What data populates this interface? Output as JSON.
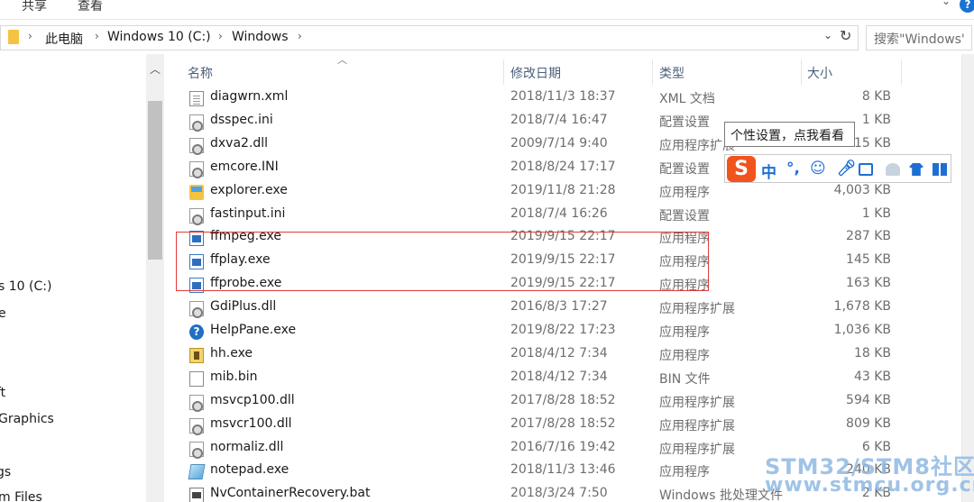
{
  "ribbon": {
    "tabs": [
      "共享",
      "查看"
    ],
    "help_label": "?"
  },
  "address": {
    "crumbs": [
      "此电脑",
      "Windows 10 (C:)",
      "Windows"
    ],
    "dropdown_glyph": "⌄",
    "refresh_glyph": "↻"
  },
  "search": {
    "placeholder": "搜索\"Windows\""
  },
  "nav": {
    "items": [
      "s 10 (C:)",
      "e",
      "ft",
      "Graphics",
      "",
      "gs",
      "m Files"
    ]
  },
  "columns": {
    "name": "名称",
    "date": "修改日期",
    "type": "类型",
    "size": "大小"
  },
  "files": [
    {
      "name": "diagwrn.xml",
      "date": "2018/11/3 18:37",
      "type": "XML 文档",
      "size": "8 KB",
      "icon": "xml-doc-icon"
    },
    {
      "name": "dsspec.ini",
      "date": "2018/7/4 16:47",
      "type": "配置设置",
      "size": "1 KB",
      "icon": "config-file-icon"
    },
    {
      "name": "dxva2.dll",
      "date": "2009/7/14 9:40",
      "type": "应用程序扩展",
      "size": "15 KB",
      "icon": "dll-file-icon"
    },
    {
      "name": "emcore.INI",
      "date": "2018/8/24 17:17",
      "type": "配置设置",
      "size": "",
      "icon": "config-file-icon"
    },
    {
      "name": "explorer.exe",
      "date": "2019/11/8 21:28",
      "type": "应用程序",
      "size": "4,003 KB",
      "icon": "explorer-icon"
    },
    {
      "name": "fastinput.ini",
      "date": "2018/7/4 16:26",
      "type": "配置设置",
      "size": "1 KB",
      "icon": "config-file-icon"
    },
    {
      "name": "ffmpeg.exe",
      "date": "2019/9/15 22:17",
      "type": "应用程序",
      "size": "287 KB",
      "icon": "app-window-icon"
    },
    {
      "name": "ffplay.exe",
      "date": "2019/9/15 22:17",
      "type": "应用程序",
      "size": "145 KB",
      "icon": "app-window-icon"
    },
    {
      "name": "ffprobe.exe",
      "date": "2019/9/15 22:17",
      "type": "应用程序",
      "size": "163 KB",
      "icon": "app-window-icon"
    },
    {
      "name": "GdiPlus.dll",
      "date": "2016/8/3 17:27",
      "type": "应用程序扩展",
      "size": "1,678 KB",
      "icon": "dll-file-icon"
    },
    {
      "name": "HelpPane.exe",
      "date": "2019/8/22 17:23",
      "type": "应用程序",
      "size": "1,036 KB",
      "icon": "help-icon"
    },
    {
      "name": "hh.exe",
      "date": "2018/4/12 7:34",
      "type": "应用程序",
      "size": "18 KB",
      "icon": "help-book-icon"
    },
    {
      "name": "mib.bin",
      "date": "2018/4/12 7:34",
      "type": "BIN 文件",
      "size": "43 KB",
      "icon": "blank-file-icon"
    },
    {
      "name": "msvcp100.dll",
      "date": "2017/8/28 18:52",
      "type": "应用程序扩展",
      "size": "594 KB",
      "icon": "dll-file-icon"
    },
    {
      "name": "msvcr100.dll",
      "date": "2017/8/28 18:52",
      "type": "应用程序扩展",
      "size": "809 KB",
      "icon": "dll-file-icon"
    },
    {
      "name": "normaliz.dll",
      "date": "2016/7/16 19:42",
      "type": "应用程序扩展",
      "size": "6 KB",
      "icon": "dll-file-icon"
    },
    {
      "name": "notepad.exe",
      "date": "2018/11/3 13:46",
      "type": "应用程序",
      "size": "240 KB",
      "icon": "notepad-icon"
    },
    {
      "name": "NvContainerRecovery.bat",
      "date": "2018/3/24 7:50",
      "type": "Windows 批处理文件",
      "size": "2 KB",
      "icon": "batch-file-icon"
    }
  ],
  "ime": {
    "tooltip": "个性设置，点我看看",
    "logo": "S",
    "mode": "中",
    "punct": "°,"
  },
  "watermark": {
    "line1": "STM32/STM8社区",
    "line2": "www.stmcu.org.cn"
  },
  "colors": {
    "accent": "#1a73d0",
    "highlight_box": "#e33a3a",
    "ime_logo": "#f0531c"
  }
}
